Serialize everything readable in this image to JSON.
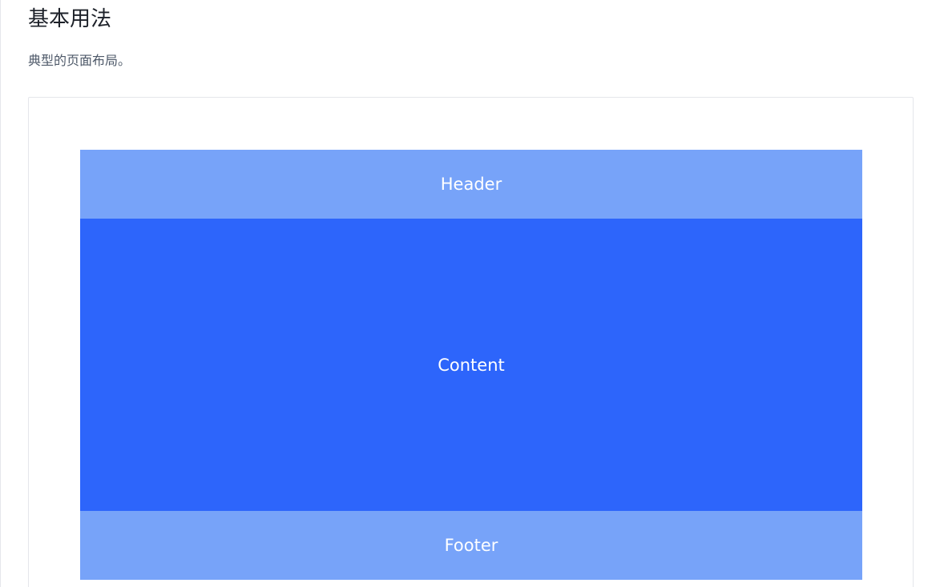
{
  "section": {
    "title": "基本用法",
    "description": "典型的页面布局。"
  },
  "demo": {
    "header_label": "Header",
    "content_label": "Content",
    "footer_label": "Footer"
  },
  "colors": {
    "header_bg": "#77a3f9",
    "content_bg": "#2d65fb",
    "footer_bg": "#77a3f9",
    "text": "#ffffff"
  }
}
